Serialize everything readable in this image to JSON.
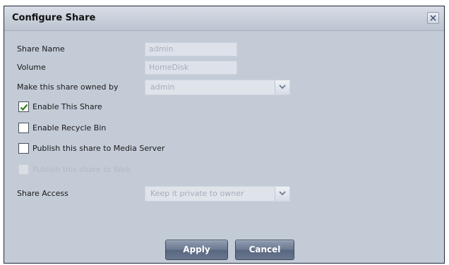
{
  "dialog": {
    "title": "Configure Share",
    "close_icon": "close-icon"
  },
  "form": {
    "share_name": {
      "label": "Share Name",
      "value": "admin"
    },
    "volume": {
      "label": "Volume",
      "value": "HomeDisk"
    },
    "owner": {
      "label": "Make this share owned by",
      "value": "admin"
    },
    "enable_share": {
      "label": "Enable This Share",
      "checked": true
    },
    "recycle_bin": {
      "label": "Enable Recycle Bin",
      "checked": false
    },
    "media_server": {
      "label": "Publish this share to Media Server",
      "checked": false
    },
    "web": {
      "label": "Publish this share to Web",
      "checked": false,
      "disabled": true
    },
    "share_access": {
      "label": "Share Access",
      "value": "Keep it private to owner"
    }
  },
  "buttons": {
    "apply": "Apply",
    "cancel": "Cancel"
  },
  "colors": {
    "dialog_bg": "#c3cbd7",
    "button_bg": "#6b7891",
    "check_color": "#2e7d1f"
  }
}
